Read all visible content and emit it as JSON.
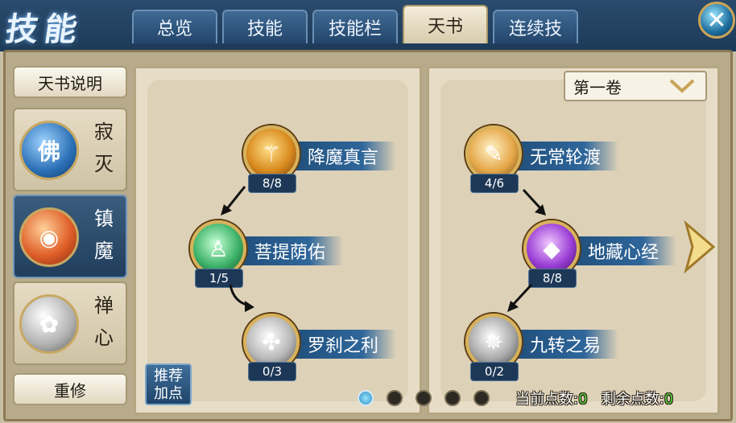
{
  "header": {
    "title": "技能",
    "tabs": [
      {
        "label": "总览"
      },
      {
        "label": "技能"
      },
      {
        "label": "技能栏"
      },
      {
        "label": "天书"
      },
      {
        "label": "连续技"
      }
    ],
    "active_tab": "天书",
    "close_icon": "close-icon"
  },
  "sidebar": {
    "info_button": "天书说明",
    "schools": [
      {
        "name_top": "寂",
        "name_bottom": "灭",
        "emblem": "佛"
      },
      {
        "name_top": "镇",
        "name_bottom": "魔",
        "emblem": "◉"
      },
      {
        "name_top": "禅",
        "name_bottom": "心",
        "emblem": "✿"
      }
    ],
    "active_school": "镇魔",
    "reset_button": "重修"
  },
  "left_tree": {
    "skills": [
      {
        "name": "降魔真言",
        "level": "8/8",
        "icon": "vajra-icon"
      },
      {
        "name": "菩提荫佑",
        "level": "1/5",
        "icon": "bodhi-figure-icon"
      },
      {
        "name": "罗刹之利",
        "level": "0/3",
        "icon": "rakshasa-icon"
      }
    ]
  },
  "right_tree": {
    "volume_select": "第一卷",
    "skills": [
      {
        "name": "无常轮渡",
        "level": "4/6",
        "icon": "scroll-rune-icon"
      },
      {
        "name": "地藏心经",
        "level": "8/8",
        "icon": "crystal-icon"
      },
      {
        "name": "九转之易",
        "level": "0/2",
        "icon": "rune-icon"
      }
    ]
  },
  "footer": {
    "recommend_button": "推荐加点",
    "pages": 5,
    "current_page": 1,
    "current_points_label": "当前点数:",
    "current_points": "0",
    "remaining_points_label": "剩余点数:",
    "remaining_points": "0"
  },
  "colors": {
    "accent_blue": "#2f669a",
    "gold": "#d7b25c",
    "points_green": "#57d33f"
  }
}
